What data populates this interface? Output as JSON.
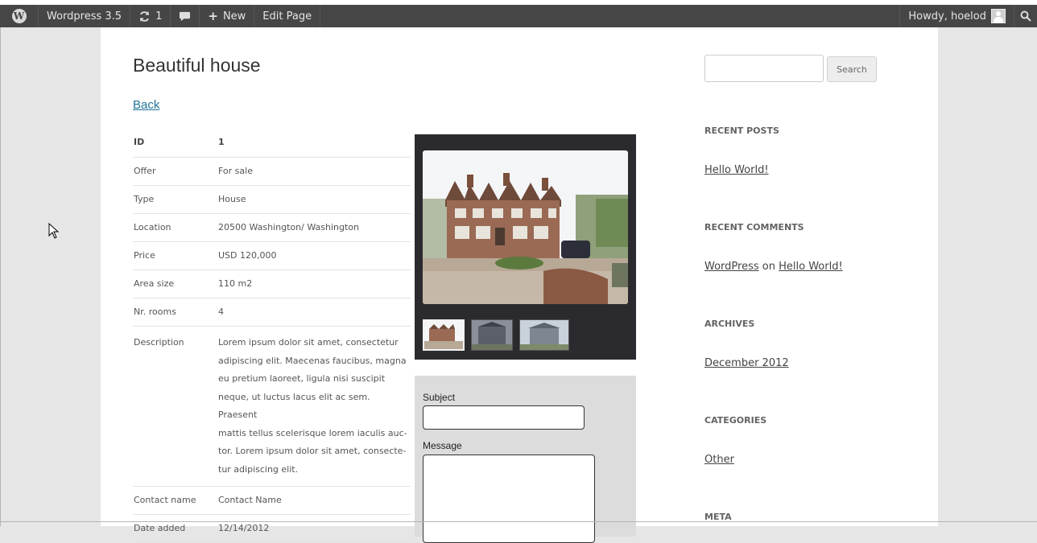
{
  "admin_bar": {
    "site_name": "Wordpress 3.5",
    "updates_count": "1",
    "new_label": "New",
    "edit_page_label": "Edit Page",
    "howdy_label": "Howdy, hoelod"
  },
  "page": {
    "title": "Beautiful house",
    "back_label": "Back"
  },
  "details": {
    "header": {
      "key": "ID",
      "value": "1"
    },
    "rows": [
      {
        "key": "Offer",
        "value": "For sale"
      },
      {
        "key": "Type",
        "value": "House"
      },
      {
        "key": "Location",
        "value": "20500 Washington/ Washington"
      },
      {
        "key": "Price",
        "value": "USD 120,000"
      },
      {
        "key": "Area size",
        "value": "110 m2"
      },
      {
        "key": "Nr. rooms",
        "value": "4"
      }
    ],
    "description": {
      "key": "Description",
      "lines": [
        "Lorem ipsum dolor sit amet, consectetur",
        "adipiscing elit. Maecenas faucibus, magna",
        "eu pretium laoreet, ligula nisi suscipit",
        "neque, ut luctus lacus elit ac sem. Praesent",
        "mattis tellus scelerisque lorem iaculis auc-",
        "tor. Lorem ipsum dolor sit amet, consecte-",
        "tur adipiscing elit."
      ]
    },
    "rows_after": [
      {
        "key": "Contact name",
        "value": "Contact Name"
      },
      {
        "key": "Date added",
        "value": "12/14/2012"
      }
    ]
  },
  "contact_form": {
    "subject_label": "Subject",
    "message_label": "Message"
  },
  "sidebar": {
    "search_button": "Search",
    "recent_posts": {
      "title": "RECENT POSTS",
      "items": [
        "Hello World!"
      ]
    },
    "recent_comments": {
      "title": "RECENT COMMENTS",
      "author": "WordPress",
      "on": "on",
      "post": "Hello World!"
    },
    "archives": {
      "title": "ARCHIVES",
      "items": [
        "December 2012"
      ]
    },
    "categories": {
      "title": "CATEGORIES",
      "items": [
        "Other"
      ]
    },
    "meta": {
      "title": "META"
    }
  },
  "colors": {
    "admin_bar": "#464646",
    "link": "#21759b",
    "gallery_bg": "#2a2a2f",
    "form_bg": "#dcdcdc"
  }
}
